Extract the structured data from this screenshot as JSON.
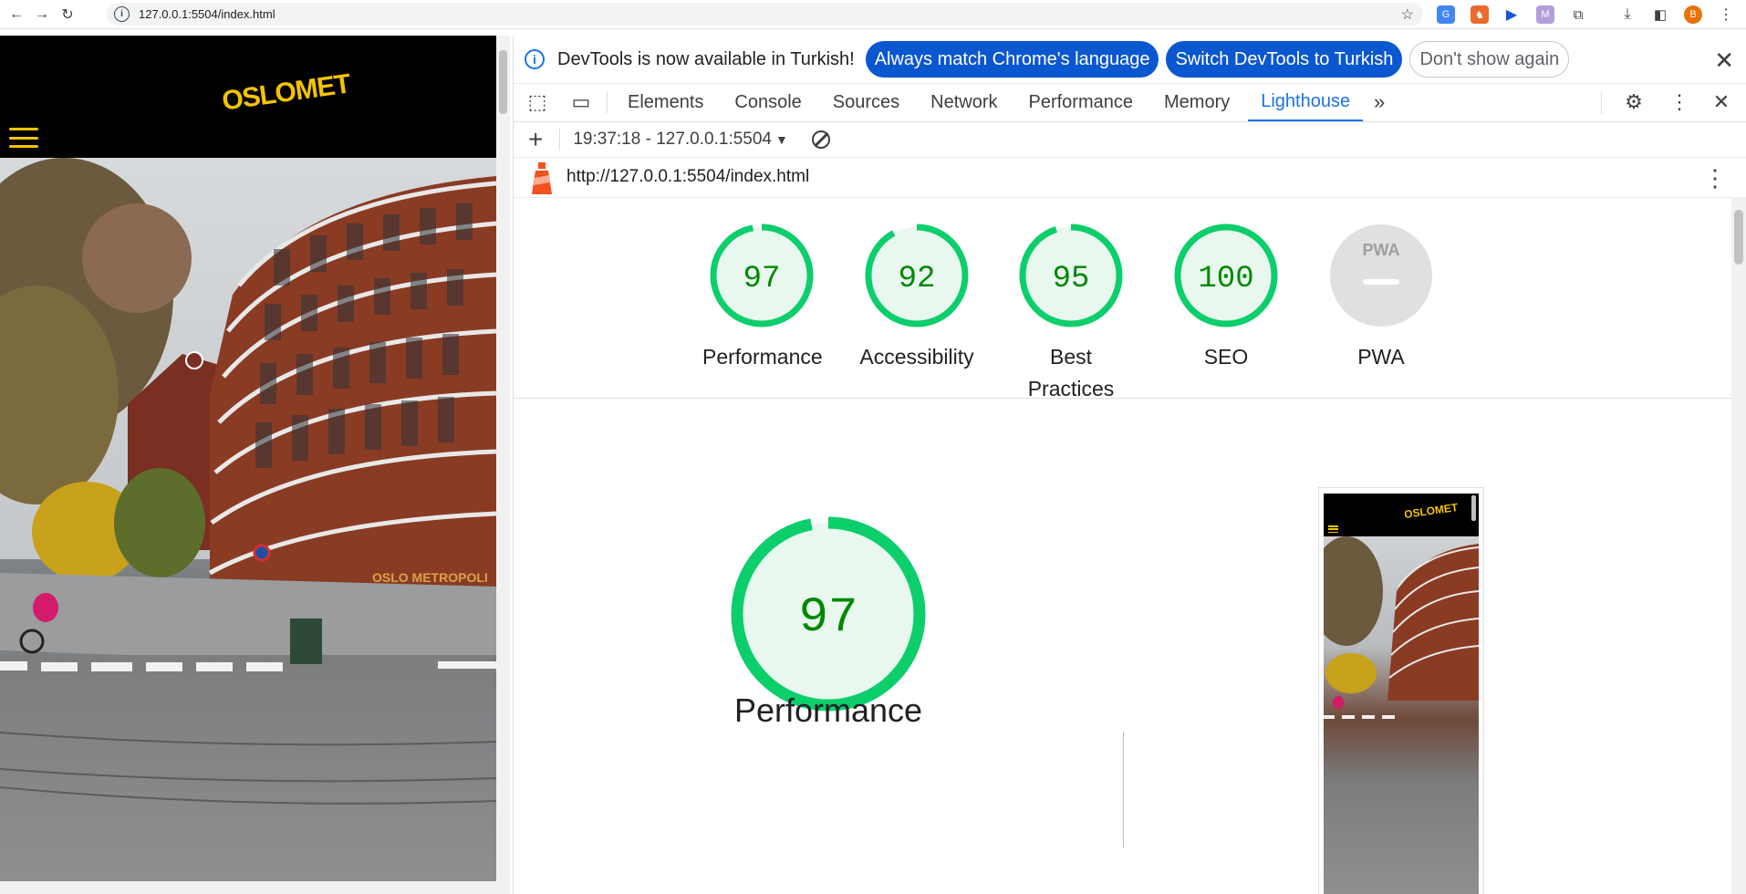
{
  "browser": {
    "url": "127.0.0.1:5504/index.html",
    "profile_initial": "B"
  },
  "site": {
    "logo": "OSLOMET",
    "building_sign": "OSLO METROPOLI"
  },
  "devtools": {
    "infobar": {
      "message": "DevTools is now available in Turkish!",
      "btn_match": "Always match Chrome's language",
      "btn_switch": "Switch DevTools to Turkish",
      "btn_dismiss": "Don't show again"
    },
    "tabs": [
      "Elements",
      "Console",
      "Sources",
      "Network",
      "Performance",
      "Memory",
      "Lighthouse"
    ],
    "active_tab": "Lighthouse",
    "report_selector": "19:37:18 - 127.0.0.1:5504",
    "report_url": "http://127.0.0.1:5504/index.html"
  },
  "lighthouse": {
    "scores": [
      {
        "label": "Performance",
        "value": "97",
        "fraction": 0.97
      },
      {
        "label": "Accessibility",
        "value": "92",
        "fraction": 0.92
      },
      {
        "label": "Best Practices",
        "value": "95",
        "fraction": 0.95
      },
      {
        "label": "SEO",
        "value": "100",
        "fraction": 1.0
      },
      {
        "label": "PWA",
        "value": "",
        "fraction": 0
      }
    ],
    "pwa_badge": "PWA",
    "main_score": "97",
    "main_fraction": 0.97,
    "main_title": "Performance",
    "colors": {
      "pass": "#0cce6b",
      "pass_fill": "#e8f8ef",
      "pass_text": "#008800",
      "na": "#e0e0e0"
    }
  }
}
